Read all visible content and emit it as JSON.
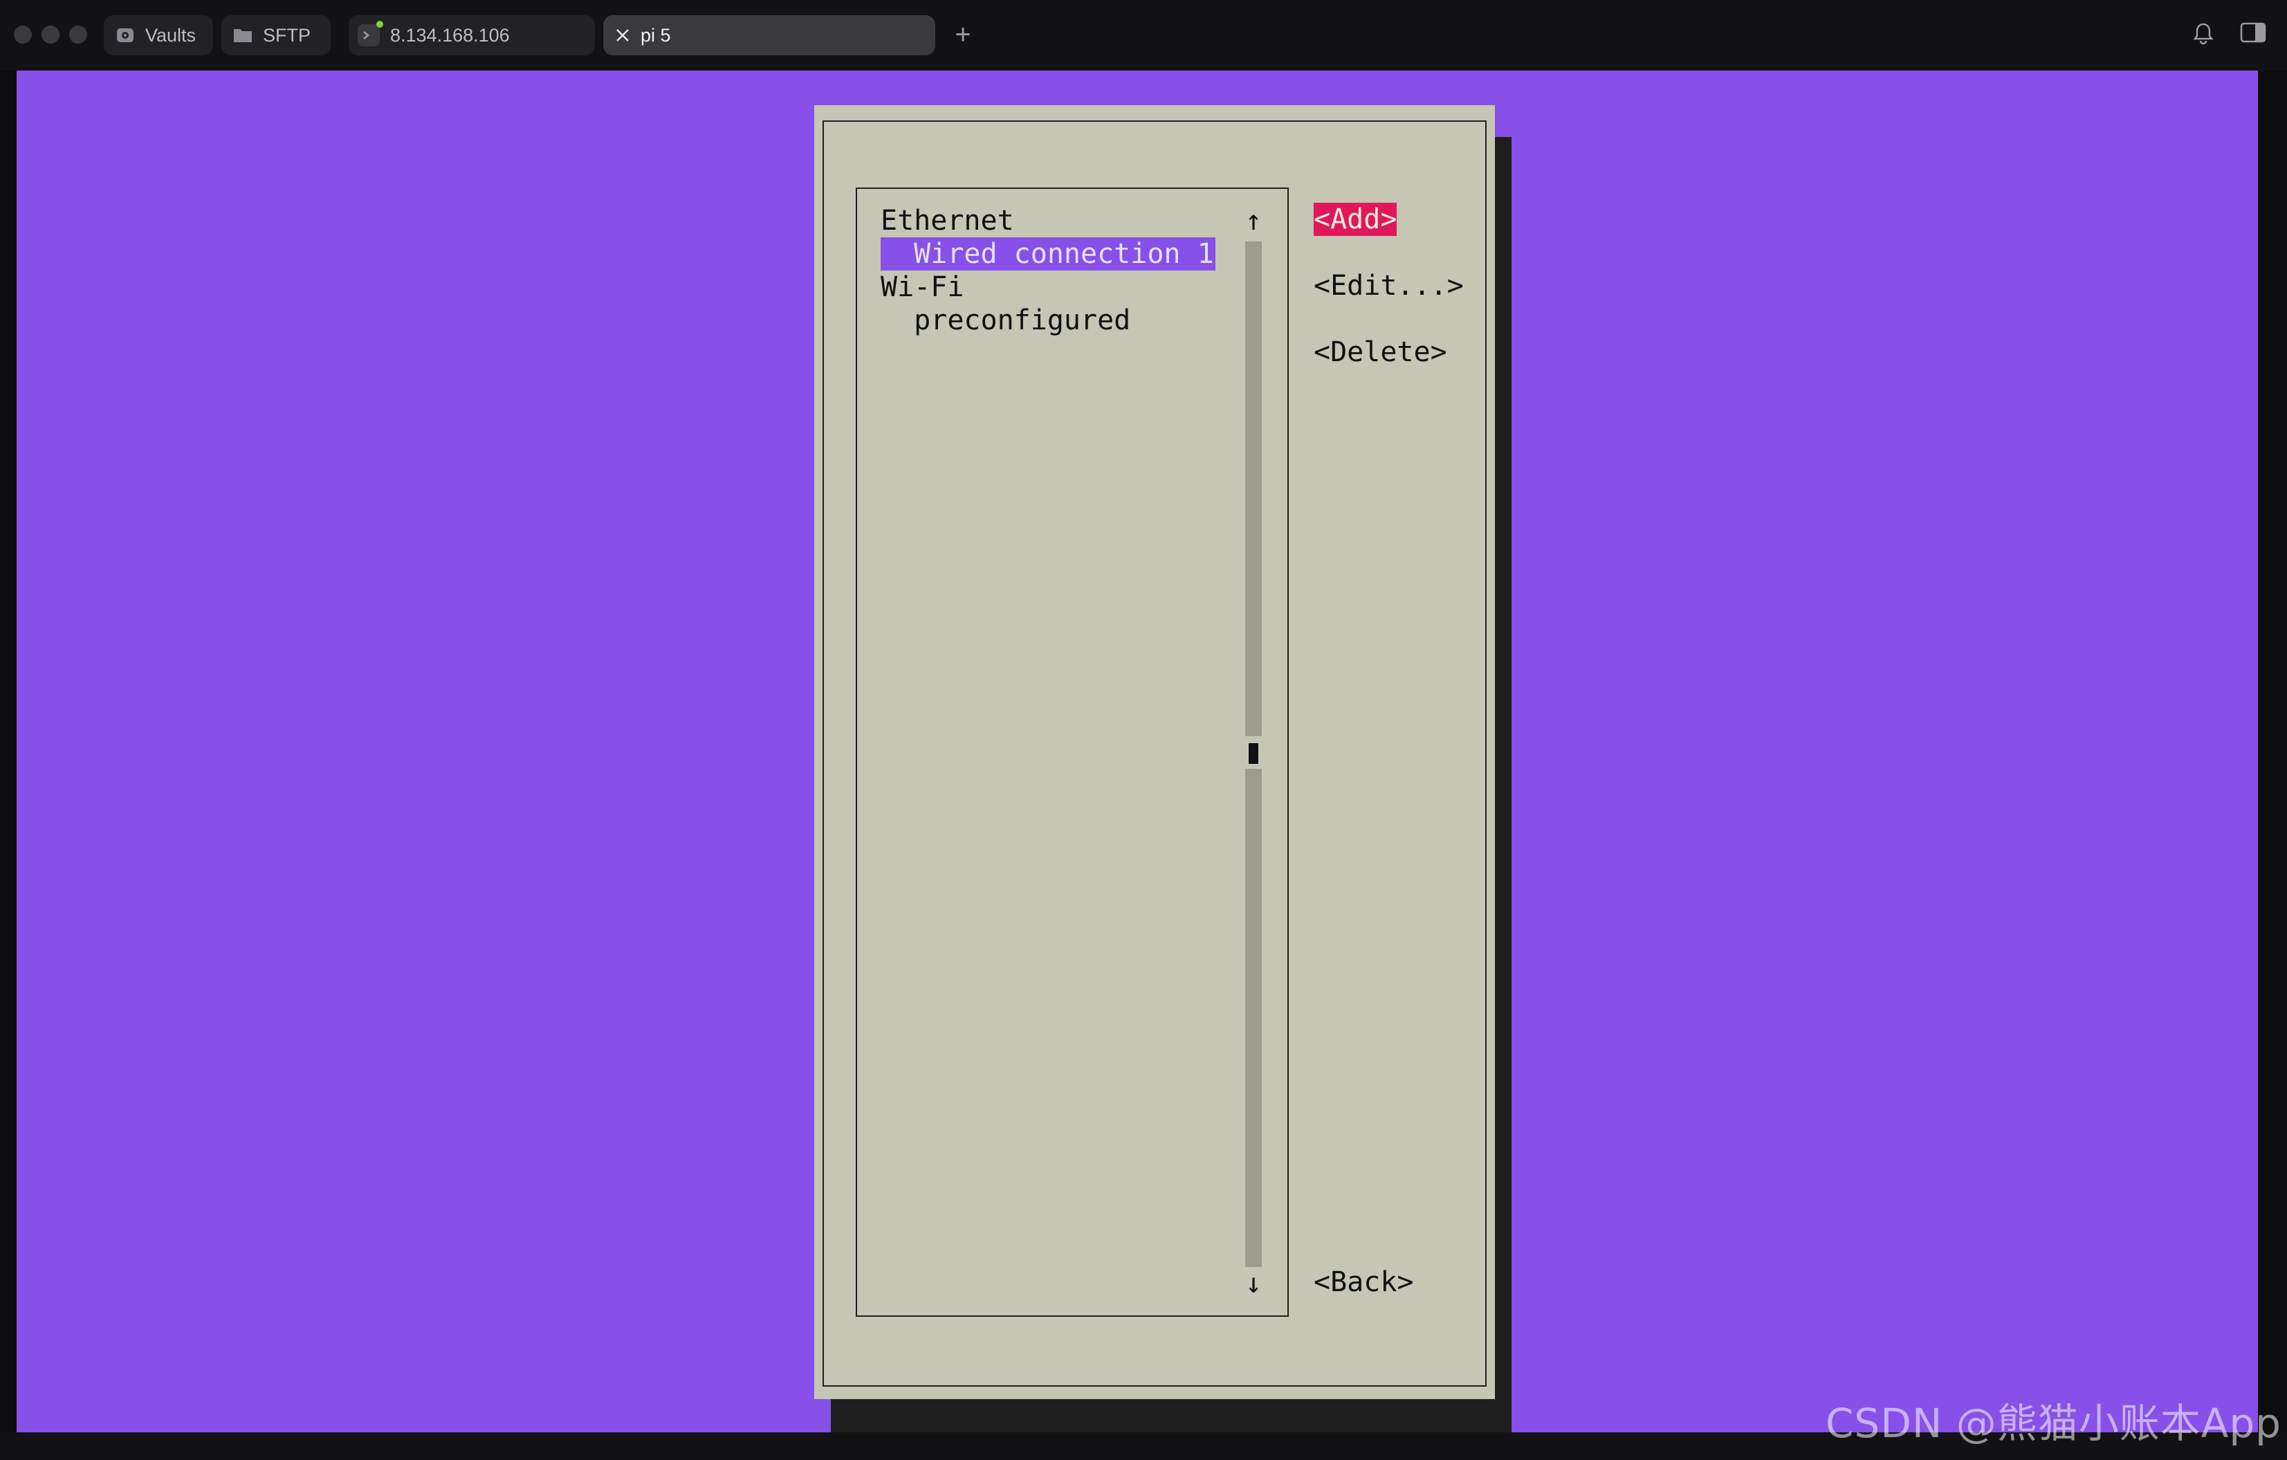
{
  "window": {
    "tabs": [
      {
        "label": "Vaults",
        "icon": "vault-icon"
      },
      {
        "label": "SFTP",
        "icon": "folder-icon"
      },
      {
        "label": "8.134.168.106",
        "icon": "terminal-host-icon",
        "status_color": "#7bd62f"
      },
      {
        "label": "pi 5",
        "icon": "close-icon",
        "active": true
      }
    ],
    "new_tab_glyph": "+",
    "right_icons": [
      "bell-icon",
      "sidebar-toggle-icon"
    ]
  },
  "terminal": {
    "background_color": "#8750e8",
    "dialog": {
      "list": {
        "items": [
          {
            "text": "Ethernet",
            "indent": 0,
            "selected": false
          },
          {
            "text": "Wired connection 1",
            "indent": 1,
            "selected": true
          },
          {
            "text": "Wi-Fi",
            "indent": 0,
            "selected": false
          },
          {
            "text": "preconfigured",
            "indent": 1,
            "selected": false
          }
        ],
        "scroll_up": "↑",
        "scroll_down": "↓"
      },
      "buttons": {
        "add": "<Add>",
        "edit": "<Edit...>",
        "delete": "<Delete>",
        "back": "<Back>"
      },
      "focus_color": "#e0185a",
      "selection_color": "#8750e8"
    }
  },
  "watermark": "CSDN @熊猫小账本App"
}
